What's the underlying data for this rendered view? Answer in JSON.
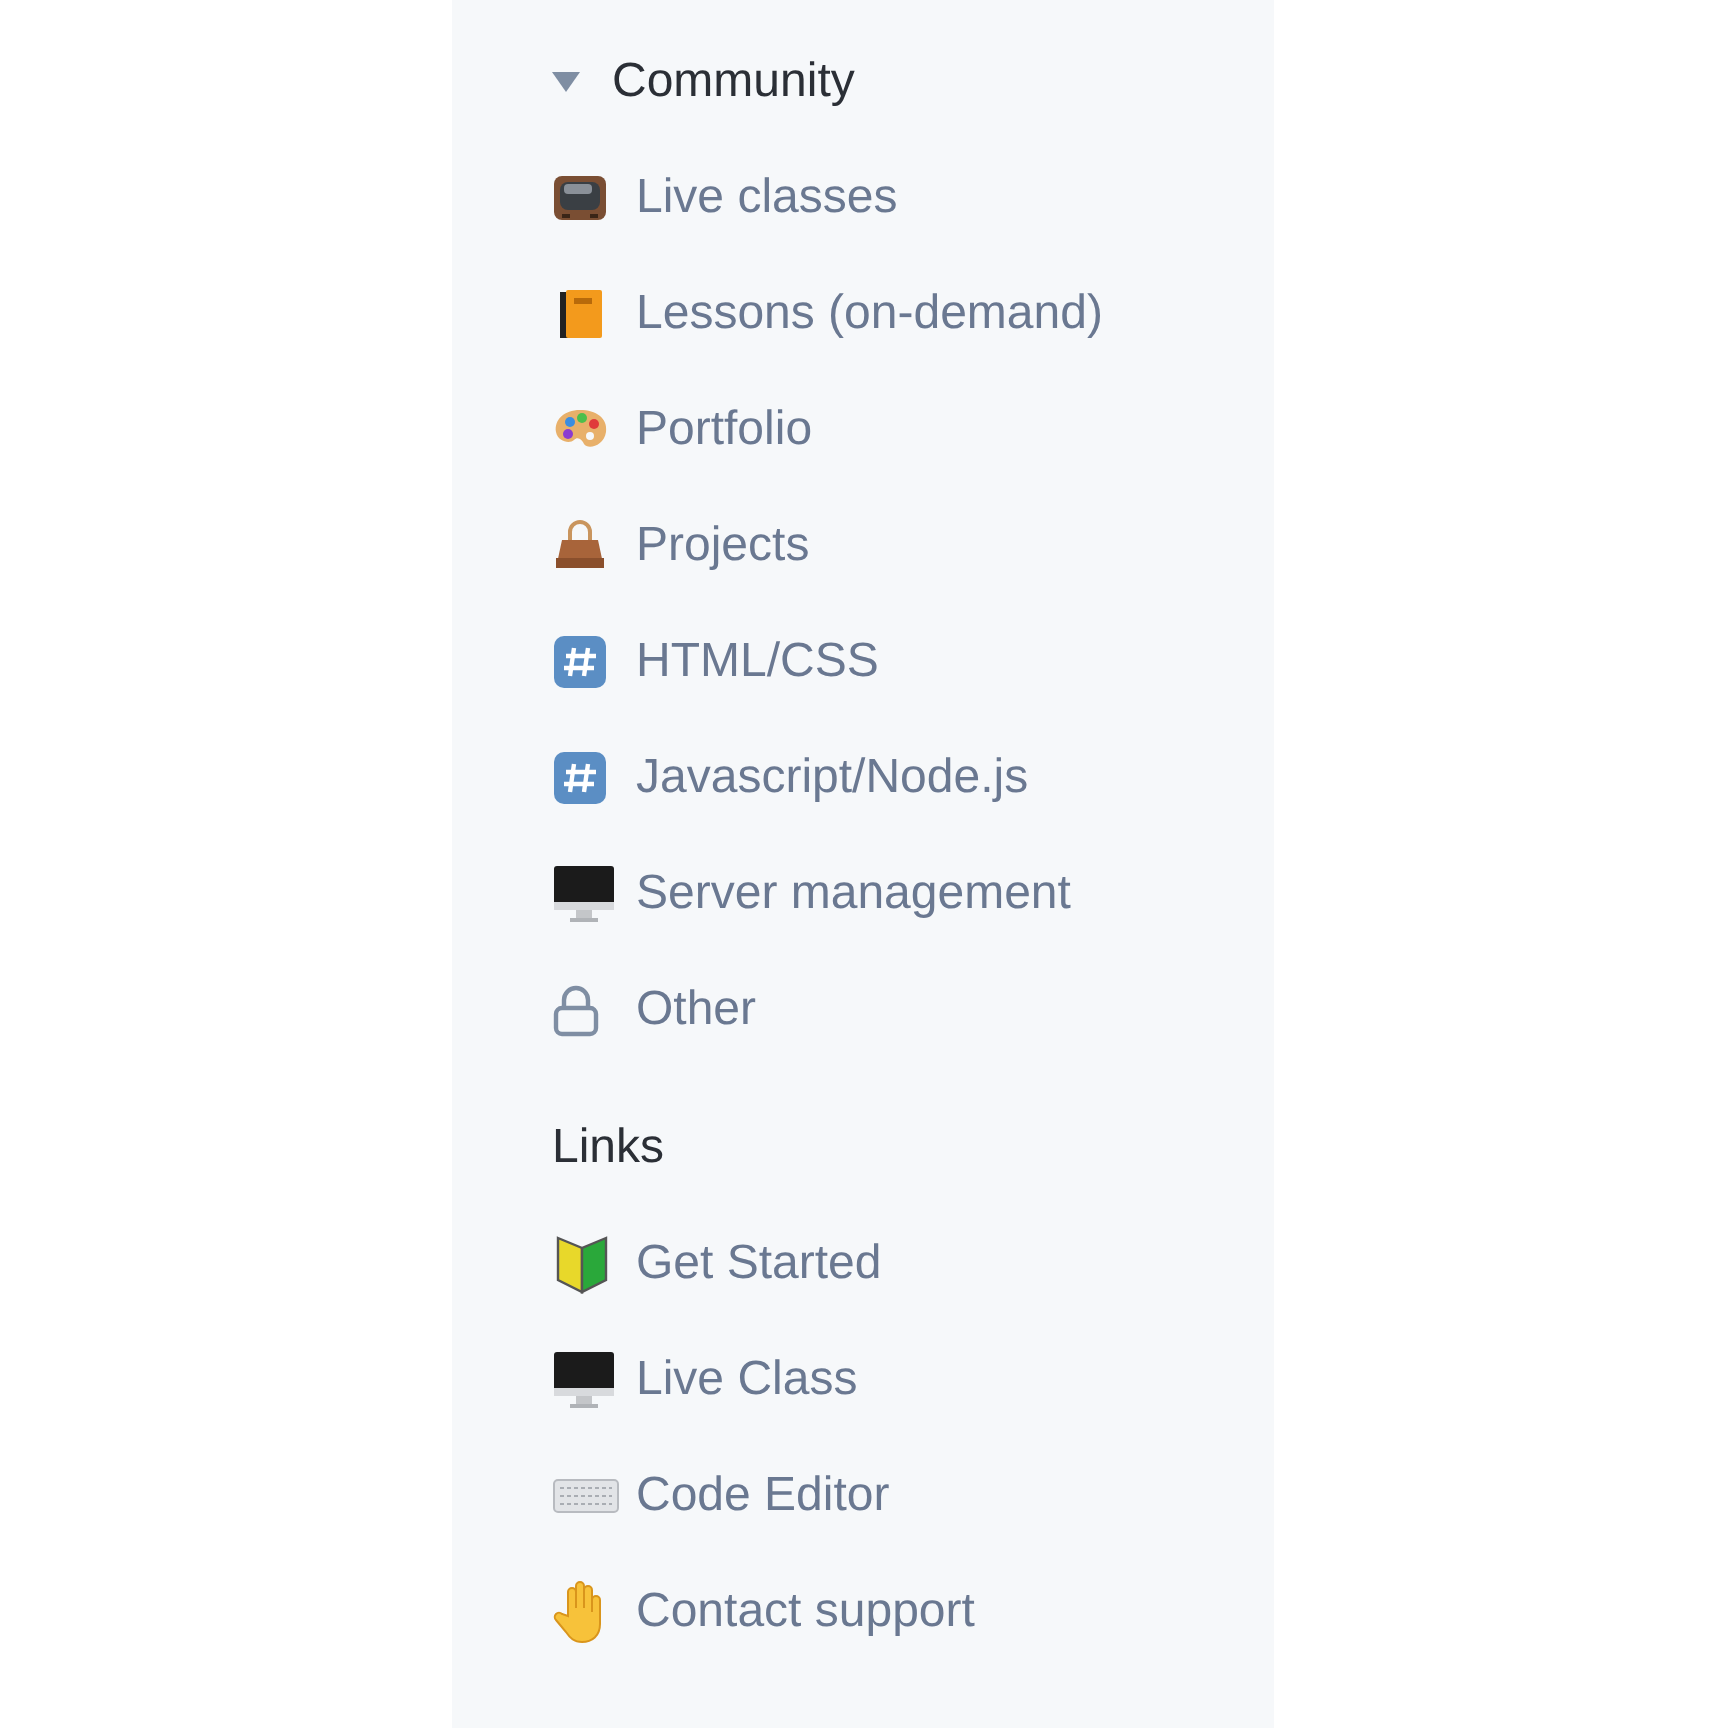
{
  "sections": [
    {
      "title": "Community",
      "expanded": true,
      "items": [
        {
          "label": "Live classes"
        },
        {
          "label": "Lessons (on-demand)"
        },
        {
          "label": "Portfolio"
        },
        {
          "label": "Projects"
        },
        {
          "label": "HTML/CSS"
        },
        {
          "label": "Javascript/Node.js"
        },
        {
          "label": "Server management"
        },
        {
          "label": "Other"
        }
      ]
    },
    {
      "title": "Links",
      "items": [
        {
          "label": "Get Started"
        },
        {
          "label": "Live Class"
        },
        {
          "label": "Code Editor"
        },
        {
          "label": "Contact support"
        }
      ]
    }
  ]
}
